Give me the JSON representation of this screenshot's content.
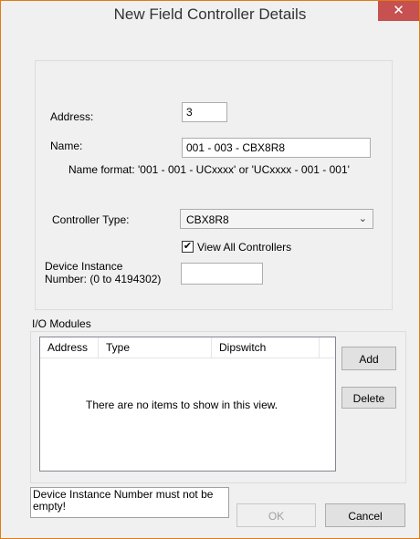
{
  "window": {
    "title": "New Field Controller Details",
    "close_glyph": "✕"
  },
  "form": {
    "address_label": "Address:",
    "address_value": "3",
    "name_label": "Name:",
    "name_value": "001 - 003 - CBX8R8",
    "name_format_hint": "Name format: '001 - 001 - UCxxxx' or 'UCxxxx - 001 - 001'",
    "controller_type_label": "Controller Type:",
    "controller_type_value": "CBX8R8",
    "view_all_label": "View All Controllers",
    "view_all_checked": true,
    "device_instance_label_line1": "Device Instance",
    "device_instance_label_line2": "Number: (0 to 4194302)",
    "device_instance_value": ""
  },
  "io_modules": {
    "label": "I/O Modules",
    "columns": [
      "Address",
      "Type",
      "Dipswitch"
    ],
    "empty_text": "There are no items to show in this view.",
    "add_label": "Add",
    "delete_label": "Delete"
  },
  "footer": {
    "status_line1": "Device Instance Number must not be",
    "status_line2": "empty!",
    "ok_label": "OK",
    "cancel_label": "Cancel"
  },
  "colors": {
    "close_button": "#c75050",
    "window_border": "#e07c14"
  },
  "icons": {
    "close": "close-icon",
    "dropdown": "chevron-down-icon",
    "check": "checkmark-icon"
  }
}
